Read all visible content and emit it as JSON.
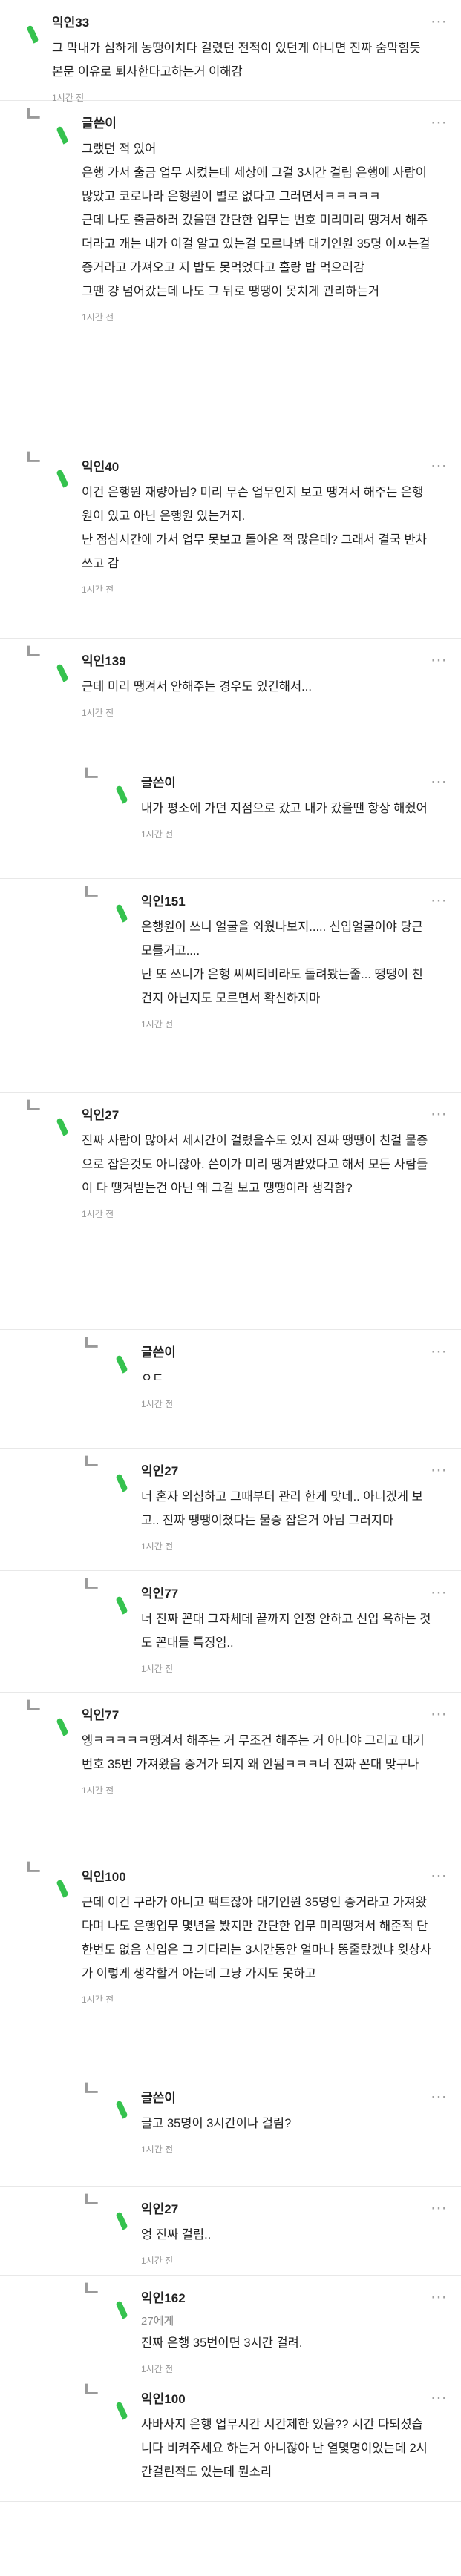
{
  "comments": [
    {
      "level": 0,
      "nick": "익인33",
      "lines": [
        "그 막내가 심하게 농땡이치다 걸렸던 전적이 있던게 아니면 진짜 숨막힘듯 본문 이유로 퇴사한다고하는거 이해감"
      ],
      "time": "1시간 전"
    },
    {
      "level": 1,
      "nick": "글쓴이",
      "lines": [
        "그랬던 적 있어",
        "은행 가서 출금 업무 시켰는데 세상에 그걸 3시간 걸림 은행에 사람이 많았고 코로나라 은행원이 별로 없다고 그러면서ㅋㅋㅋㅋㅋ",
        "근데 나도 출금하러 갔을땐 간단한 업무는 번호 미리미리 땡겨서 해주더라고 개는 내가 이걸 알고 있는걸 모르나봐 대기인원 35명 이ㅆ는걸 증거라고 가져오고 지 밥도 못먹었다고 홀랑 밥 먹으러감",
        "그땐 걍 넘어갔는데 나도 그 뒤로 땡땡이 못치게 관리하는거"
      ],
      "time": "1시간 전"
    },
    {
      "level": 1,
      "nick": "익인40",
      "lines": [
        "이건 은행원 재량아님? 미리 무슨 업무인지 보고 땡겨서 해주는 은행원이 있고 아닌 은행원 있는거지.",
        "난 점심시간에 가서 업무 못보고 돌아온 적 많은데? 그래서 결국 반차쓰고 감"
      ],
      "time": "1시간 전"
    },
    {
      "level": 1,
      "nick": "익인139",
      "lines": [
        "근데 미리 땡겨서 안해주는 경우도 있긴해서..."
      ],
      "time": "1시간 전"
    },
    {
      "level": 2,
      "nick": "글쓴이",
      "lines": [
        "내가 평소에 가던 지점으로 갔고 내가 갔을땐 항상 해줬어"
      ],
      "time": "1시간 전"
    },
    {
      "level": 2,
      "nick": "익인151",
      "lines": [
        "은행원이 쓰니 얼굴을 외웠나보지..... 신입얼굴이야 당근 모를거고....",
        "난 또 쓰니가 은행 씨씨티비라도 돌려봤는줄... 땡땡이 친건지 아닌지도 모르면서 확신하지마"
      ],
      "time": "1시간 전"
    },
    {
      "level": 1,
      "nick": "익인27",
      "lines": [
        "진짜 사람이 많아서 세시간이 걸렸을수도 있지 진짜 땡땡이 친걸 물증으로 잡은것도 아니잖아. 쓴이가 미리 땡겨받았다고 해서 모든 사람들이 다 땡겨받는건 아닌 왜 그걸 보고 땡땡이라 생각함?"
      ],
      "time": "1시간 전"
    },
    {
      "level": 2,
      "nick": "글쓴이",
      "lines": [
        "ㅇㄷ"
      ],
      "time": "1시간 전"
    },
    {
      "level": 2,
      "nick": "익인27",
      "lines": [
        "너 혼자 의심하고 그때부터 관리 한게 맞네.. 아니겠게 보고.. 진짜 땡땡이쳤다는 물증 잡은거 아님 그러지마"
      ],
      "time": "1시간 전"
    },
    {
      "level": 2,
      "nick": "익인77",
      "lines": [
        "너 진짜 꼰대 그자체데 끝까지 인정 안하고 신입 욕하는 것도 꼰대들 특징임.."
      ],
      "time": "1시간 전"
    },
    {
      "level": 1,
      "nick": "익인77",
      "lines": [
        "엥ㅋㅋㅋㅋㅋ땡겨서 해주는 거 무조건 해주는 거 아니야 그리고 대기 번호 35번 가져왔음 증거가 되지 왜 안됨ㅋㅋㅋ너 진짜 꼰대 맞구나"
      ],
      "time": "1시간 전"
    },
    {
      "level": 1,
      "nick": "익인100",
      "lines": [
        "근데 이건 구라가 아니고 팩트잖아 대기인원 35명인 증거라고 가져왔다며 나도 은행업무 몇년을 봤지만 간단한 업무 미리땡겨서 해준적 단한번도 없음 신입은 그 기다리는 3시간동안 얼마나 똥줄탔겠냐 윗상사가 이렇게 생각할거 아는데 그냥 가지도 못하고"
      ],
      "time": "1시간 전"
    },
    {
      "level": 2,
      "nick": "글쓴이",
      "lines": [
        "글고 35명이 3시간이나 걸림?"
      ],
      "time": "1시간 전"
    },
    {
      "level": 2,
      "nick": "익인27",
      "lines": [
        "엉 진짜 걸림.."
      ],
      "time": "1시간 전"
    },
    {
      "level": 2,
      "nick": "익인162",
      "mention": "27에게",
      "lines": [
        "진짜 은행 35번이면 3시간 걸려."
      ],
      "time": "1시간 전"
    },
    {
      "level": 2,
      "nick": "익인100",
      "lines": [
        "사바사지 은행 업무시간 시간제한 있음?? 시간 다되셨습니다 비켜주세요 하는거 아니잖아 난 열몇명이었는데 2시간걸린적도 있는데 뭔소리"
      ],
      "time": ""
    }
  ],
  "more_icon": "⋯"
}
